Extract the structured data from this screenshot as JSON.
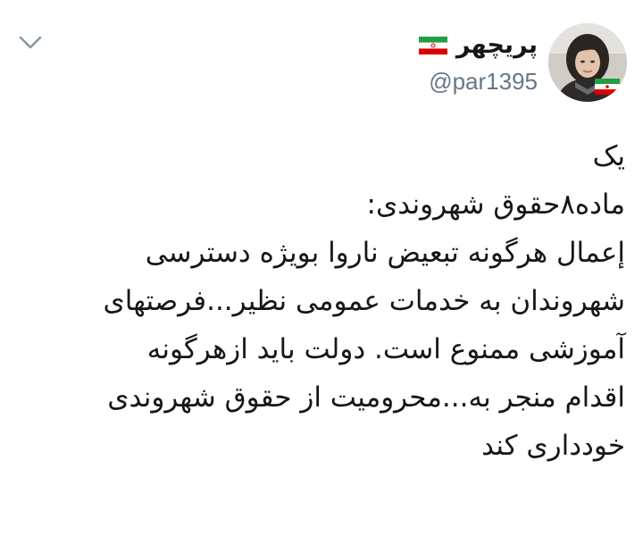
{
  "author": {
    "display_name": "پریچهر",
    "handle": "@par1395",
    "avatar_icon": "profile-photo-avatar",
    "badge_icon": "iran-flag-icon"
  },
  "controls": {
    "menu_icon": "chevron-down-icon"
  },
  "tweet": {
    "lines": [
      "یک",
      "ماده۸حقوق شهروندی:",
      "إعمال هرگونه تبعیض ناروا بویژه دسترسی",
      "شهروندان به خدمات عمومی نظیر...فرصتهای",
      "آموزشی ممنوع است. دولت باید ازهرگونه",
      "اقدام منجر به...محرومیت از حقوق شهروندی",
      "خودداری کند"
    ]
  },
  "colors": {
    "text": "#14171a",
    "secondary_text": "#657786",
    "flag_green": "#239f40",
    "flag_white": "#ffffff",
    "flag_red": "#da0000"
  }
}
